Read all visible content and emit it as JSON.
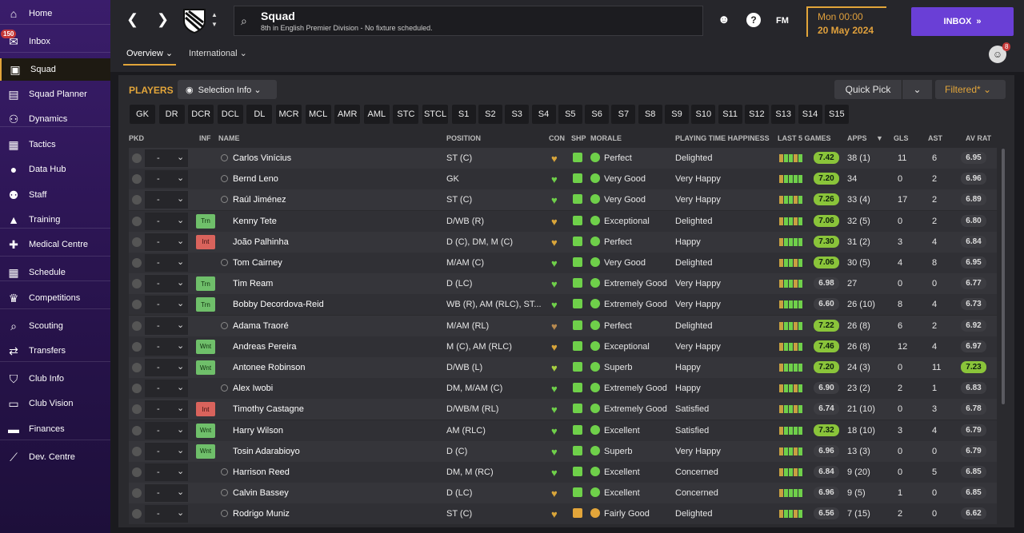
{
  "sidebar": {
    "inbox_badge": "150",
    "items": [
      {
        "label": "Home",
        "icon": "home-icon",
        "glyph": "⌂"
      },
      {
        "label": "Inbox",
        "icon": "inbox-icon",
        "glyph": "✉"
      },
      {
        "label": "Squad",
        "icon": "shirt-icon",
        "glyph": "▣"
      },
      {
        "label": "Squad Planner",
        "icon": "clipboard-icon",
        "glyph": "▤"
      },
      {
        "label": "Dynamics",
        "icon": "people-icon",
        "glyph": "⚇"
      },
      {
        "label": "Tactics",
        "icon": "board-icon",
        "glyph": "▦"
      },
      {
        "label": "Data Hub",
        "icon": "globe-icon",
        "glyph": "●"
      },
      {
        "label": "Staff",
        "icon": "staff-icon",
        "glyph": "⚉"
      },
      {
        "label": "Training",
        "icon": "cone-icon",
        "glyph": "▲"
      },
      {
        "label": "Medical Centre",
        "icon": "medical-icon",
        "glyph": "✚"
      },
      {
        "label": "Schedule",
        "icon": "calendar-icon",
        "glyph": "▦"
      },
      {
        "label": "Competitions",
        "icon": "trophy-icon",
        "glyph": "♛"
      },
      {
        "label": "Scouting",
        "icon": "search-icon",
        "glyph": "⌕"
      },
      {
        "label": "Transfers",
        "icon": "transfer-icon",
        "glyph": "⇄"
      },
      {
        "label": "Club Info",
        "icon": "shield-icon",
        "glyph": "⛉"
      },
      {
        "label": "Club Vision",
        "icon": "briefcase-icon",
        "glyph": "▭"
      },
      {
        "label": "Finances",
        "icon": "money-icon",
        "glyph": "▬"
      },
      {
        "label": "Dev. Centre",
        "icon": "chart-icon",
        "glyph": "⟋"
      }
    ]
  },
  "header": {
    "title": "Squad",
    "subtitle": "8th in English Premier Division - No fixture scheduled.",
    "date_line1": "Mon 00:00",
    "date_line2": "20 May 2024",
    "inbox_label": "INBOX",
    "fm_label": "FM",
    "help_label": "?",
    "avatar_badge": "8",
    "tabs": [
      {
        "label": "Overview ⌄"
      },
      {
        "label": "International ⌄"
      }
    ]
  },
  "toolbar": {
    "players_label": "PLAYERS",
    "selection_info": "Selection Info ⌄",
    "quick_pick": "Quick Pick",
    "filtered": "Filtered* ⌄"
  },
  "positions": [
    "GK",
    "DR",
    "DCR",
    "DCL",
    "DL",
    "MCR",
    "MCL",
    "AMR",
    "AML",
    "STC",
    "STCL",
    "S1",
    "S2",
    "S3",
    "S4",
    "S5",
    "S6",
    "S7",
    "S8",
    "S9",
    "S10",
    "S11",
    "S12",
    "S13",
    "S14",
    "S15"
  ],
  "columns": {
    "pkd": "PKD",
    "inf": "INF",
    "name": "NAME",
    "position": "POSITION",
    "con": "CON",
    "shp": "SHP",
    "morale": "MORALE",
    "pth": "PLAYING TIME HAPPINESS",
    "last5": "LAST 5 GAMES",
    "apps": "APPS",
    "gls": "GLS",
    "ast": "AST",
    "avrat": "AV RAT"
  },
  "colors": {
    "accent": "#e2a53a",
    "inbox": "#6a3fd6",
    "green": "#6fd04a",
    "rating_green": "#8ac43a"
  },
  "players": [
    {
      "name": "Carlos Vinícius",
      "pos": "ST (C)",
      "inf": "",
      "morale": "Perfect",
      "pth": "Delighted",
      "last5": "7.42",
      "apps": "38 (1)",
      "gls": "11",
      "ast": "6",
      "av": "6.95",
      "con": "gold",
      "sel": "-"
    },
    {
      "name": "Bernd Leno",
      "pos": "GK",
      "inf": "",
      "morale": "Very Good",
      "pth": "Very Happy",
      "last5": "7.20",
      "apps": "34",
      "gls": "0",
      "ast": "2",
      "av": "6.96",
      "con": "green",
      "sel": "-"
    },
    {
      "name": "Raúl Jiménez",
      "pos": "ST (C)",
      "inf": "",
      "morale": "Very Good",
      "pth": "Very Happy",
      "last5": "7.26",
      "apps": "33 (4)",
      "gls": "17",
      "ast": "2",
      "av": "6.89",
      "con": "green",
      "sel": "-"
    },
    {
      "name": "Kenny Tete",
      "pos": "D/WB (R)",
      "inf": "Trn",
      "morale": "Exceptional",
      "pth": "Delighted",
      "last5": "7.06",
      "apps": "32 (5)",
      "gls": "0",
      "ast": "2",
      "av": "6.80",
      "con": "gold",
      "sel": "-"
    },
    {
      "name": "João Palhinha",
      "pos": "D (C), DM, M (C)",
      "inf": "Int",
      "morale": "Perfect",
      "pth": "Happy",
      "last5": "7.30",
      "apps": "31 (2)",
      "gls": "3",
      "ast": "4",
      "av": "6.84",
      "con": "gold",
      "sel": "-"
    },
    {
      "name": "Tom Cairney",
      "pos": "M/AM (C)",
      "inf": "",
      "morale": "Very Good",
      "pth": "Delighted",
      "last5": "7.06",
      "apps": "30 (5)",
      "gls": "4",
      "ast": "8",
      "av": "6.95",
      "con": "green",
      "sel": "-"
    },
    {
      "name": "Tim Ream",
      "pos": "D (LC)",
      "inf": "Trn",
      "morale": "Extremely Good",
      "pth": "Very Happy",
      "last5": "6.98",
      "apps": "27",
      "gls": "0",
      "ast": "0",
      "av": "6.77",
      "con": "green",
      "sel": "-"
    },
    {
      "name": "Bobby Decordova-Reid",
      "pos": "WB (R), AM (RLC), ST...",
      "inf": "Trn",
      "morale": "Extremely Good",
      "pth": "Very Happy",
      "last5": "6.60",
      "apps": "26 (10)",
      "gls": "8",
      "ast": "4",
      "av": "6.73",
      "con": "green",
      "sel": "-"
    },
    {
      "name": "Adama Traoré",
      "pos": "M/AM (RL)",
      "inf": "",
      "morale": "Perfect",
      "pth": "Delighted",
      "last5": "7.22",
      "apps": "26 (8)",
      "gls": "6",
      "ast": "2",
      "av": "6.92",
      "con": "brown",
      "sel": "-"
    },
    {
      "name": "Andreas Pereira",
      "pos": "M (C), AM (RLC)",
      "inf": "Wnt",
      "morale": "Exceptional",
      "pth": "Very Happy",
      "last5": "7.46",
      "apps": "26 (8)",
      "gls": "12",
      "ast": "4",
      "av": "6.97",
      "con": "gold",
      "sel": "-"
    },
    {
      "name": "Antonee Robinson",
      "pos": "D/WB (L)",
      "inf": "Wnt",
      "morale": "Superb",
      "pth": "Happy",
      "last5": "7.20",
      "apps": "24 (3)",
      "gls": "0",
      "ast": "11",
      "av": "7.23",
      "con": "yellowgreen",
      "sel": "-"
    },
    {
      "name": "Alex Iwobi",
      "pos": "DM, M/AM (C)",
      "inf": "",
      "morale": "Extremely Good",
      "pth": "Happy",
      "last5": "6.90",
      "apps": "23 (2)",
      "gls": "2",
      "ast": "1",
      "av": "6.83",
      "con": "green",
      "sel": "-"
    },
    {
      "name": "Timothy Castagne",
      "pos": "D/WB/M (RL)",
      "inf": "Int",
      "morale": "Extremely Good",
      "pth": "Satisfied",
      "last5": "6.74",
      "apps": "21 (10)",
      "gls": "0",
      "ast": "3",
      "av": "6.78",
      "con": "green",
      "sel": "-"
    },
    {
      "name": "Harry Wilson",
      "pos": "AM (RLC)",
      "inf": "Wnt",
      "morale": "Excellent",
      "pth": "Satisfied",
      "last5": "7.32",
      "apps": "18 (10)",
      "gls": "3",
      "ast": "4",
      "av": "6.79",
      "con": "green",
      "sel": "-"
    },
    {
      "name": "Tosin Adarabioyo",
      "pos": "D (C)",
      "inf": "Wnt",
      "morale": "Superb",
      "pth": "Very Happy",
      "last5": "6.96",
      "apps": "13 (3)",
      "gls": "0",
      "ast": "0",
      "av": "6.79",
      "con": "green",
      "sel": "-"
    },
    {
      "name": "Harrison Reed",
      "pos": "DM, M (RC)",
      "inf": "",
      "morale": "Excellent",
      "pth": "Concerned",
      "last5": "6.84",
      "apps": "9 (20)",
      "gls": "0",
      "ast": "5",
      "av": "6.85",
      "con": "green",
      "sel": "-"
    },
    {
      "name": "Calvin Bassey",
      "pos": "D (LC)",
      "inf": "",
      "morale": "Excellent",
      "pth": "Concerned",
      "last5": "6.96",
      "apps": "9 (5)",
      "gls": "1",
      "ast": "0",
      "av": "6.85",
      "con": "gold",
      "sel": "-"
    },
    {
      "name": "Rodrigo Muniz",
      "pos": "ST (C)",
      "inf": "",
      "morale": "Fairly Good",
      "pth": "Delighted",
      "last5": "6.56",
      "apps": "7 (15)",
      "gls": "2",
      "ast": "0",
      "av": "6.62",
      "con": "gold",
      "sel": "-"
    }
  ]
}
